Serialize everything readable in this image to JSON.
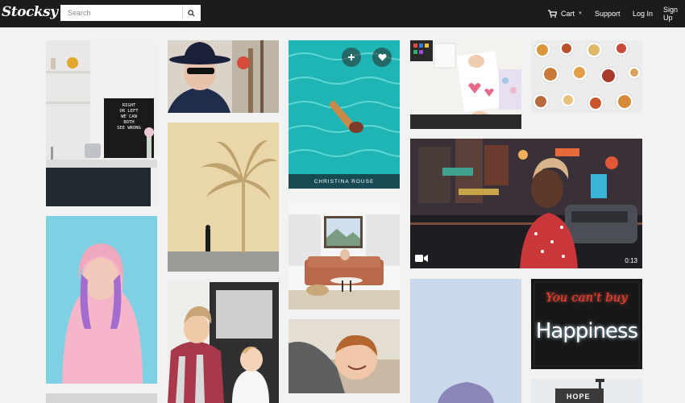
{
  "header": {
    "logo": "Stocksy",
    "search": {
      "placeholder": "Search",
      "value": ""
    },
    "nav": {
      "cart": "Cart",
      "support": "Support",
      "login": "Log In",
      "signup": "Sign Up"
    }
  },
  "tiles": {
    "kitchen": {
      "board_text": "RIGHT OR LEFT WE CAN BOTH SEE WRONG"
    },
    "pool": {
      "photographer": "CHRISTINA ROUSE"
    },
    "city_video": {
      "duration": "0:13"
    },
    "neon": {
      "line1": "You can't buy",
      "line2": "Happiness"
    },
    "street_sign": {
      "text": "HOPE"
    }
  },
  "colors": {
    "header_bg": "#1c1c1c",
    "page_bg": "#f2f2f2",
    "pool": "#1fb5b5",
    "hoodie": "#f4b6c8",
    "neon_red": "#ff3b30"
  }
}
